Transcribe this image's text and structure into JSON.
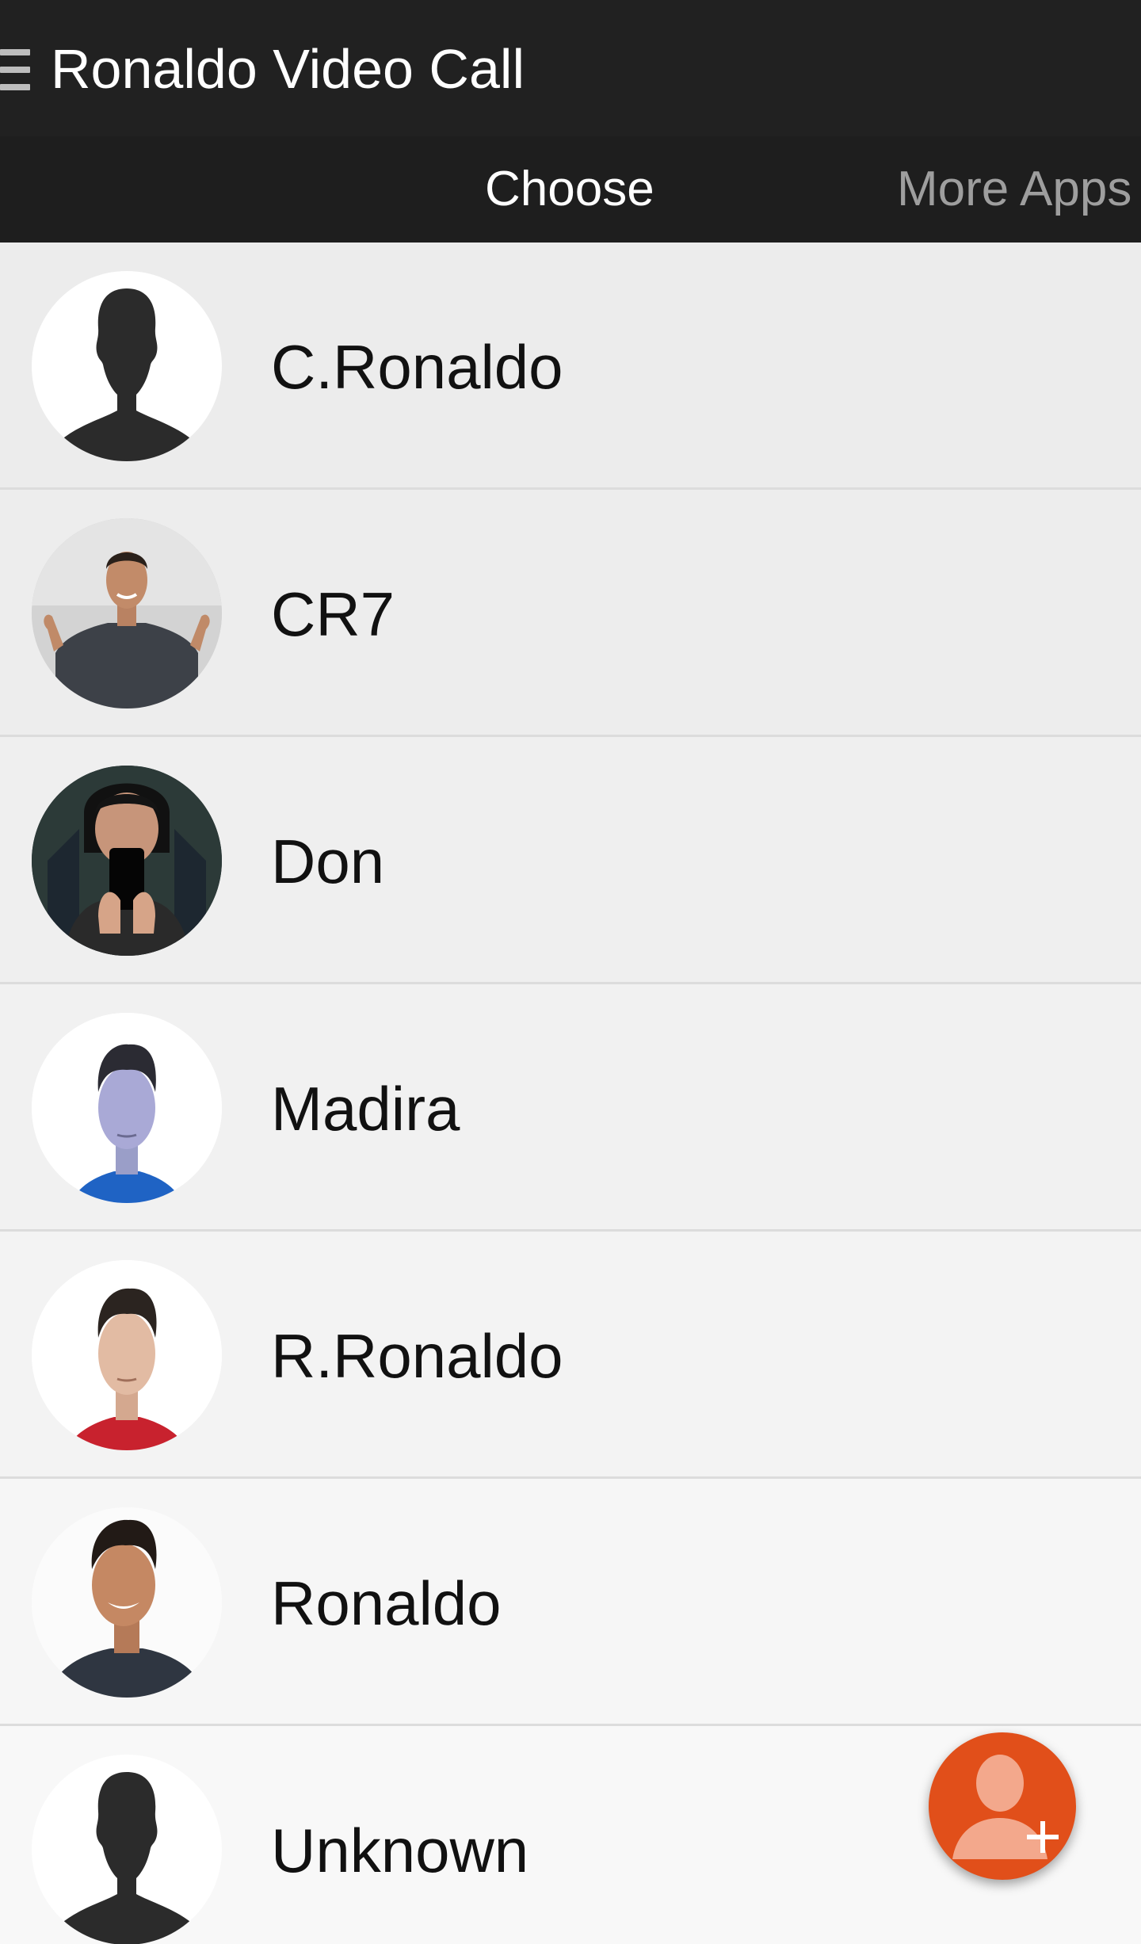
{
  "app_bar": {
    "title": "Ronaldo Video Call",
    "menu_icon": "hamburger-menu-icon"
  },
  "tabs": [
    {
      "label": "Choose",
      "selected": true
    },
    {
      "label": "More Apps",
      "selected": false
    }
  ],
  "contacts": [
    {
      "name": "C.Ronaldo",
      "avatar": "silhouette-avatar"
    },
    {
      "name": "CR7",
      "avatar": "photo-avatar"
    },
    {
      "name": "Don",
      "avatar": "photo-avatar"
    },
    {
      "name": "Madira",
      "avatar": "photo-avatar"
    },
    {
      "name": "R.Ronaldo",
      "avatar": "photo-avatar"
    },
    {
      "name": "Ronaldo",
      "avatar": "photo-avatar"
    },
    {
      "name": "Unknown",
      "avatar": "silhouette-avatar"
    }
  ],
  "fab": {
    "icon": "add-contact-icon"
  },
  "colors": {
    "app_bar": "#212121",
    "tab_bar": "#1e1e1e",
    "list_background": "#f2f2f2",
    "fab": "#e14f1a"
  }
}
